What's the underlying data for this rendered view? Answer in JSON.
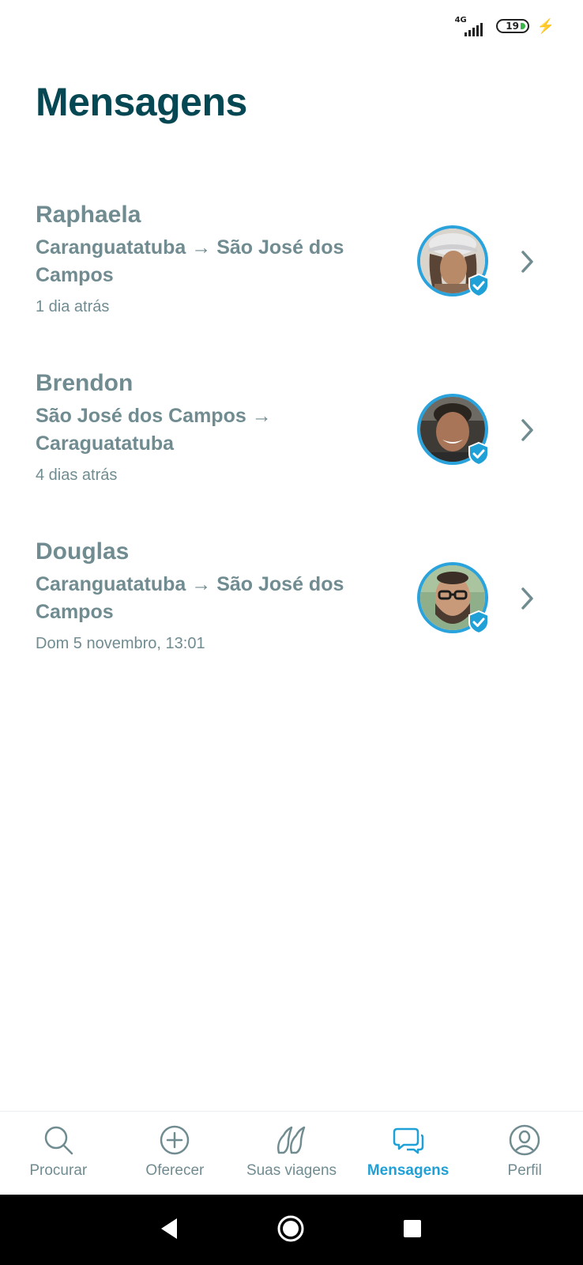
{
  "status": {
    "network": "4G",
    "battery": "19"
  },
  "header": {
    "title": "Mensagens"
  },
  "conversations": [
    {
      "name": "Raphaela",
      "route": "Caranguatatuba → São José dos Campos",
      "time": "1 dia atrás"
    },
    {
      "name": "Brendon",
      "route": "São José dos Campos → Caraguatatuba",
      "time": "4 dias atrás"
    },
    {
      "name": "Douglas",
      "route": "Caranguatatuba → São José dos Campos",
      "time": "Dom 5 novembro, 13:01"
    }
  ],
  "nav": {
    "items": [
      {
        "label": "Procurar",
        "icon": "search-icon"
      },
      {
        "label": "Oferecer",
        "icon": "plus-circle-icon"
      },
      {
        "label": "Suas viagens",
        "icon": "trips-icon"
      },
      {
        "label": "Mensagens",
        "icon": "chat-icon",
        "active": true
      },
      {
        "label": "Perfil",
        "icon": "profile-icon"
      }
    ]
  },
  "colors": {
    "title": "#054752",
    "text": "#708c91",
    "accent": "#1fa0d6"
  }
}
